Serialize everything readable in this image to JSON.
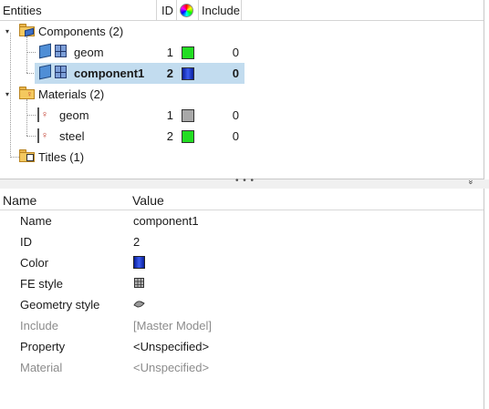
{
  "tree": {
    "headers": {
      "entities": "Entities",
      "id": "ID",
      "color_icon": "color-wheel-icon",
      "include": "Include"
    },
    "rows": [
      {
        "label": "Components (2)",
        "type": "folder",
        "folder_overlay": "component-icon"
      },
      {
        "label": "geom",
        "type": "component",
        "id": "1",
        "color": "#22dd22",
        "include": "0"
      },
      {
        "label": "component1",
        "type": "component",
        "id": "2",
        "color": "#1f3fd8",
        "include": "0",
        "selected": true
      },
      {
        "label": "Materials (2)",
        "type": "folder",
        "folder_overlay": "material-icon"
      },
      {
        "label": "geom",
        "type": "material",
        "id": "1",
        "color": "#a8a8a8",
        "include": "0"
      },
      {
        "label": "steel",
        "type": "material",
        "id": "2",
        "color": "#22dd22",
        "include": "0"
      },
      {
        "label": "Titles (1)",
        "type": "folder",
        "folder_overlay": "title-icon"
      }
    ]
  },
  "splitter": {
    "grip": "• • •",
    "collapse_glyph": "»"
  },
  "properties": {
    "headers": {
      "name": "Name",
      "value": "Value"
    },
    "rows": [
      {
        "name": "Name",
        "value": "component1"
      },
      {
        "name": "ID",
        "value": "2"
      },
      {
        "name": "Color",
        "value_swatch": "#1f3fd8"
      },
      {
        "name": "FE style",
        "value_icon": "fe-style-icon"
      },
      {
        "name": "Geometry style",
        "value_icon": "geometry-style-icon"
      },
      {
        "name": "Include",
        "value": "[Master Model]",
        "disabled": true
      },
      {
        "name": "Property",
        "value": "<Unspecified>"
      },
      {
        "name": "Material",
        "value": "<Unspecified>",
        "disabled": true
      }
    ]
  }
}
